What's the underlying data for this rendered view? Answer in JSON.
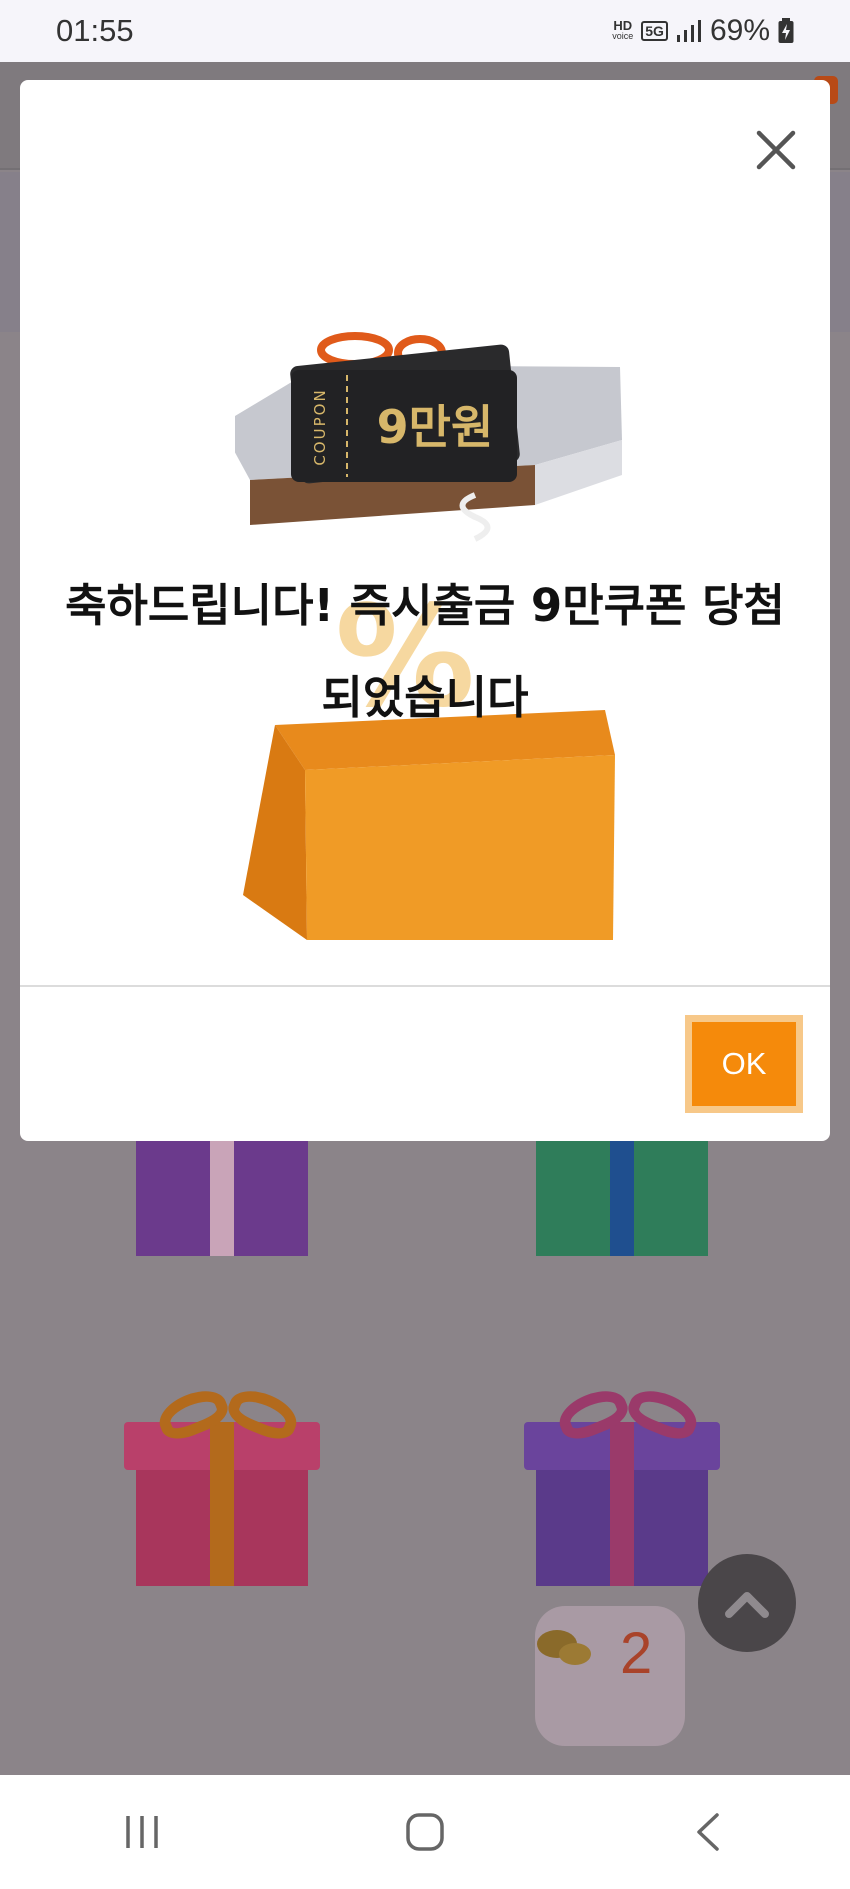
{
  "status_bar": {
    "time": "01:55",
    "hd_label": "HD",
    "voice_label": "voice",
    "network_label": "5G",
    "battery_percent": "69%"
  },
  "dialog": {
    "coupon_word": "COUPON",
    "coupon_amount": "9만원",
    "message_line1": "축하드립니다! 즉시출금 9만쿠폰 당첨",
    "message_line2": "되었습니다",
    "ok_label": "OK",
    "close_icon": "close-icon"
  },
  "background": {
    "chat_unread_count": "2",
    "gift_colors": {
      "purple": "#6b3a8c",
      "green": "#2f7d5a",
      "pink": "#a8365c",
      "violet": "#5a3a8a"
    }
  },
  "colors": {
    "accent": "#f58a0b",
    "overlay": "#888286"
  },
  "nav_bar": {
    "recent_icon": "recent-apps-icon",
    "home_icon": "home-icon",
    "back_icon": "back-icon"
  }
}
